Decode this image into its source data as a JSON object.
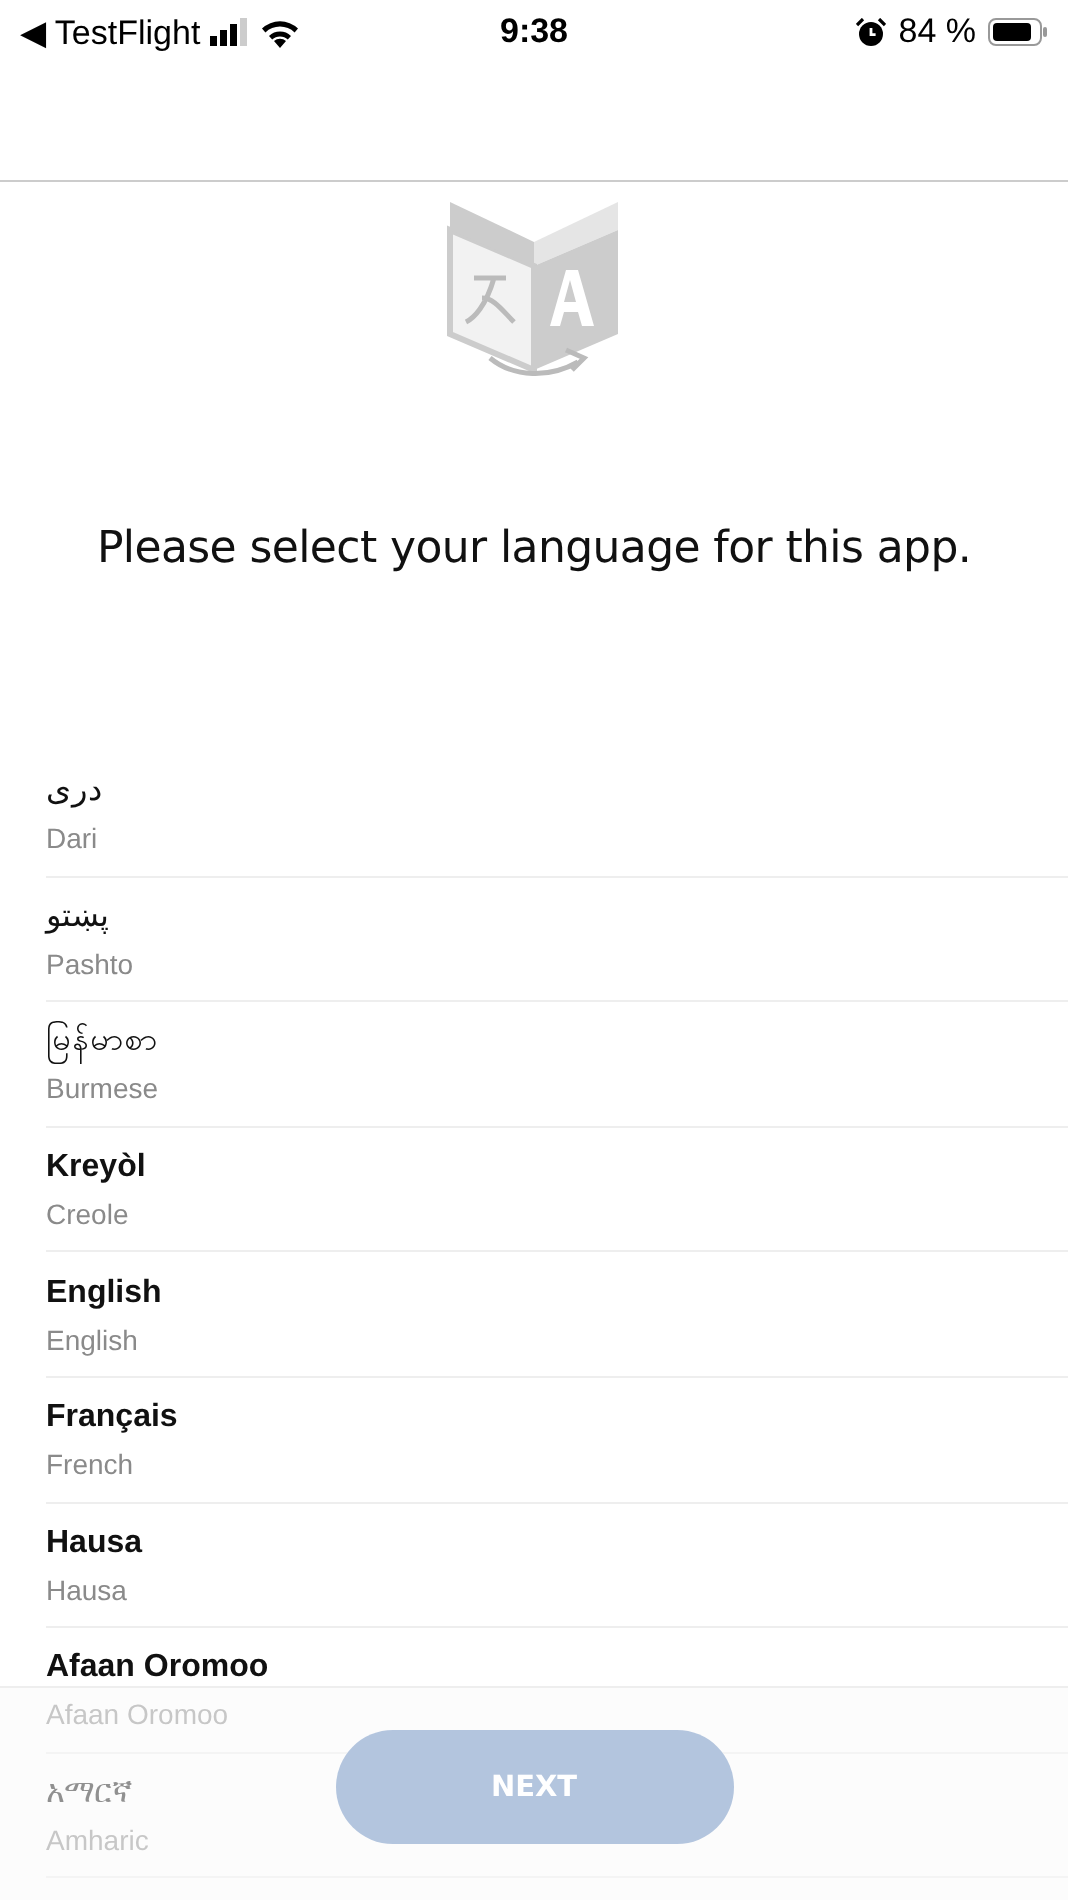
{
  "status_bar": {
    "back_label": "◀ TestFlight",
    "time": "9:38",
    "battery": "84 %"
  },
  "heading": "Please select your language for this app.",
  "languages": [
    {
      "native": "دری",
      "english": "Dari",
      "kind": "script"
    },
    {
      "native": "پښتو",
      "english": "Pashto",
      "kind": "script"
    },
    {
      "native": "မြန်မာစာ",
      "english": "Burmese",
      "kind": "script"
    },
    {
      "native": "Kreyòl",
      "english": "Creole",
      "kind": "latin"
    },
    {
      "native": "English",
      "english": "English",
      "kind": "latin"
    },
    {
      "native": "Français",
      "english": "French",
      "kind": "latin"
    },
    {
      "native": "Hausa",
      "english": "Hausa",
      "kind": "latin"
    },
    {
      "native": "Afaan Oromoo",
      "english": "Afaan Oromoo",
      "kind": "latin"
    },
    {
      "native": "አማርኛ",
      "english": "Amharic",
      "kind": "script"
    }
  ],
  "next_button": {
    "label": "NEXT",
    "disabled": true
  }
}
